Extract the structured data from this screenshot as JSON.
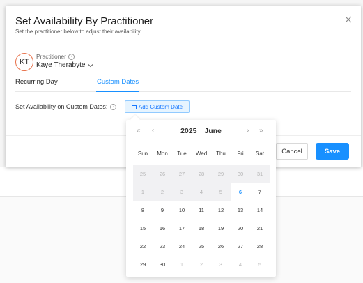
{
  "modal": {
    "title": "Set Availability By Practitioner",
    "subtitle": "Set the practitioner below to adjust their availability.",
    "practitioner_label": "Practitioner",
    "practitioner_initials": "KT",
    "practitioner_name": "Kaye Therabyte",
    "tabs": [
      {
        "label": "Recurring Day",
        "active": false
      },
      {
        "label": "Custom Dates",
        "active": true
      }
    ],
    "custom_dates_label": "Set Availability on Custom Dates:",
    "add_custom_date_label": "Add Custom Date",
    "cancel_label": "Cancel",
    "save_label": "Save",
    "accent_color": "#1890ff",
    "avatar_border_color": "#e8714a"
  },
  "picker": {
    "year": "2025",
    "month": "June",
    "nav": {
      "super_prev": "«",
      "prev": "‹",
      "next": "›",
      "super_next": "»"
    },
    "weekdays": [
      "Sun",
      "Mon",
      "Tue",
      "Wed",
      "Thu",
      "Fri",
      "Sat"
    ],
    "today": "6",
    "days": [
      [
        "25",
        "26",
        "27",
        "28",
        "29",
        "30",
        "31"
      ],
      [
        "1",
        "2",
        "3",
        "4",
        "5",
        "6",
        "7"
      ],
      [
        "8",
        "9",
        "10",
        "11",
        "12",
        "13",
        "14"
      ],
      [
        "15",
        "16",
        "17",
        "18",
        "19",
        "20",
        "21"
      ],
      [
        "22",
        "23",
        "24",
        "25",
        "26",
        "27",
        "28"
      ],
      [
        "29",
        "30",
        "1",
        "2",
        "3",
        "4",
        "5"
      ]
    ]
  }
}
